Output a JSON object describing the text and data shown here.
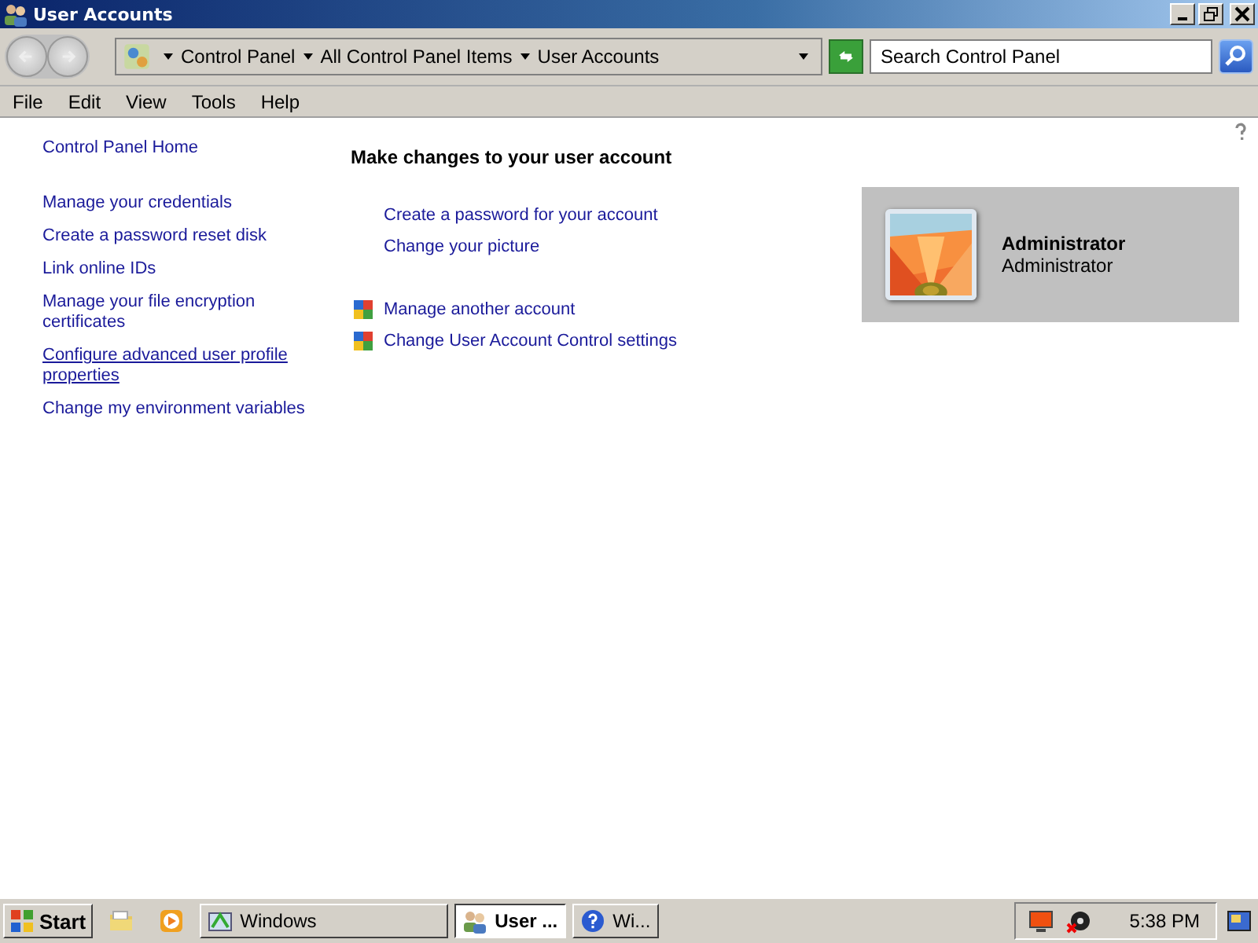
{
  "window": {
    "title": "User Accounts"
  },
  "address_bar": {
    "breadcrumbs": [
      "Control Panel",
      "All Control Panel Items",
      "User Accounts"
    ]
  },
  "search": {
    "placeholder": "Search Control Panel"
  },
  "menu": [
    "File",
    "Edit",
    "View",
    "Tools",
    "Help"
  ],
  "sidebar": {
    "home": "Control Panel Home",
    "links": [
      {
        "label": "Manage your credentials",
        "hovered": false
      },
      {
        "label": "Create a password reset disk",
        "hovered": false
      },
      {
        "label": "Link online IDs",
        "hovered": false
      },
      {
        "label": "Manage your file encryption certificates",
        "hovered": false
      },
      {
        "label": "Configure advanced user profile properties",
        "hovered": true
      },
      {
        "label": "Change my environment variables",
        "hovered": false
      }
    ]
  },
  "main": {
    "heading": "Make changes to your user account",
    "tasks": [
      {
        "label": "Create a password for your account",
        "kind": "plain"
      },
      {
        "label": "Change your picture",
        "kind": "plain"
      },
      {
        "label": "Manage another account",
        "kind": "shield"
      },
      {
        "label": "Change User Account Control settings",
        "kind": "shield"
      }
    ]
  },
  "account": {
    "name": "Administrator",
    "role": "Administrator"
  },
  "taskbar": {
    "start": "Start",
    "buttons": [
      {
        "label": "Windows",
        "selected": false,
        "kind": "explorer"
      },
      {
        "label": "User ...",
        "selected": true,
        "kind": "users"
      },
      {
        "label": "Wi...",
        "selected": false,
        "kind": "help"
      }
    ],
    "clock": "5:38 PM"
  }
}
